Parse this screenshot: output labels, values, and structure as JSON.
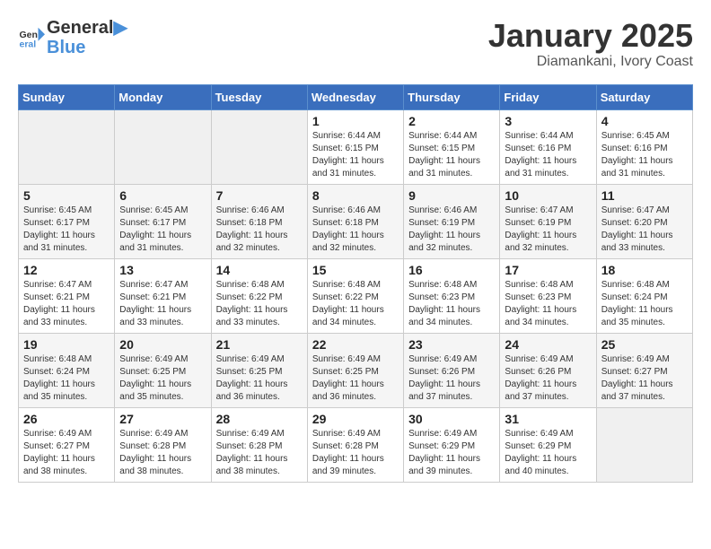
{
  "header": {
    "logo_line1": "General",
    "logo_line2": "Blue",
    "title": "January 2025",
    "subtitle": "Diamankani, Ivory Coast"
  },
  "weekdays": [
    "Sunday",
    "Monday",
    "Tuesday",
    "Wednesday",
    "Thursday",
    "Friday",
    "Saturday"
  ],
  "weeks": [
    [
      {
        "day": "",
        "info": ""
      },
      {
        "day": "",
        "info": ""
      },
      {
        "day": "",
        "info": ""
      },
      {
        "day": "1",
        "info": "Sunrise: 6:44 AM\nSunset: 6:15 PM\nDaylight: 11 hours\nand 31 minutes."
      },
      {
        "day": "2",
        "info": "Sunrise: 6:44 AM\nSunset: 6:15 PM\nDaylight: 11 hours\nand 31 minutes."
      },
      {
        "day": "3",
        "info": "Sunrise: 6:44 AM\nSunset: 6:16 PM\nDaylight: 11 hours\nand 31 minutes."
      },
      {
        "day": "4",
        "info": "Sunrise: 6:45 AM\nSunset: 6:16 PM\nDaylight: 11 hours\nand 31 minutes."
      }
    ],
    [
      {
        "day": "5",
        "info": "Sunrise: 6:45 AM\nSunset: 6:17 PM\nDaylight: 11 hours\nand 31 minutes."
      },
      {
        "day": "6",
        "info": "Sunrise: 6:45 AM\nSunset: 6:17 PM\nDaylight: 11 hours\nand 31 minutes."
      },
      {
        "day": "7",
        "info": "Sunrise: 6:46 AM\nSunset: 6:18 PM\nDaylight: 11 hours\nand 32 minutes."
      },
      {
        "day": "8",
        "info": "Sunrise: 6:46 AM\nSunset: 6:18 PM\nDaylight: 11 hours\nand 32 minutes."
      },
      {
        "day": "9",
        "info": "Sunrise: 6:46 AM\nSunset: 6:19 PM\nDaylight: 11 hours\nand 32 minutes."
      },
      {
        "day": "10",
        "info": "Sunrise: 6:47 AM\nSunset: 6:19 PM\nDaylight: 11 hours\nand 32 minutes."
      },
      {
        "day": "11",
        "info": "Sunrise: 6:47 AM\nSunset: 6:20 PM\nDaylight: 11 hours\nand 33 minutes."
      }
    ],
    [
      {
        "day": "12",
        "info": "Sunrise: 6:47 AM\nSunset: 6:21 PM\nDaylight: 11 hours\nand 33 minutes."
      },
      {
        "day": "13",
        "info": "Sunrise: 6:47 AM\nSunset: 6:21 PM\nDaylight: 11 hours\nand 33 minutes."
      },
      {
        "day": "14",
        "info": "Sunrise: 6:48 AM\nSunset: 6:22 PM\nDaylight: 11 hours\nand 33 minutes."
      },
      {
        "day": "15",
        "info": "Sunrise: 6:48 AM\nSunset: 6:22 PM\nDaylight: 11 hours\nand 34 minutes."
      },
      {
        "day": "16",
        "info": "Sunrise: 6:48 AM\nSunset: 6:23 PM\nDaylight: 11 hours\nand 34 minutes."
      },
      {
        "day": "17",
        "info": "Sunrise: 6:48 AM\nSunset: 6:23 PM\nDaylight: 11 hours\nand 34 minutes."
      },
      {
        "day": "18",
        "info": "Sunrise: 6:48 AM\nSunset: 6:24 PM\nDaylight: 11 hours\nand 35 minutes."
      }
    ],
    [
      {
        "day": "19",
        "info": "Sunrise: 6:48 AM\nSunset: 6:24 PM\nDaylight: 11 hours\nand 35 minutes."
      },
      {
        "day": "20",
        "info": "Sunrise: 6:49 AM\nSunset: 6:25 PM\nDaylight: 11 hours\nand 35 minutes."
      },
      {
        "day": "21",
        "info": "Sunrise: 6:49 AM\nSunset: 6:25 PM\nDaylight: 11 hours\nand 36 minutes."
      },
      {
        "day": "22",
        "info": "Sunrise: 6:49 AM\nSunset: 6:25 PM\nDaylight: 11 hours\nand 36 minutes."
      },
      {
        "day": "23",
        "info": "Sunrise: 6:49 AM\nSunset: 6:26 PM\nDaylight: 11 hours\nand 37 minutes."
      },
      {
        "day": "24",
        "info": "Sunrise: 6:49 AM\nSunset: 6:26 PM\nDaylight: 11 hours\nand 37 minutes."
      },
      {
        "day": "25",
        "info": "Sunrise: 6:49 AM\nSunset: 6:27 PM\nDaylight: 11 hours\nand 37 minutes."
      }
    ],
    [
      {
        "day": "26",
        "info": "Sunrise: 6:49 AM\nSunset: 6:27 PM\nDaylight: 11 hours\nand 38 minutes."
      },
      {
        "day": "27",
        "info": "Sunrise: 6:49 AM\nSunset: 6:28 PM\nDaylight: 11 hours\nand 38 minutes."
      },
      {
        "day": "28",
        "info": "Sunrise: 6:49 AM\nSunset: 6:28 PM\nDaylight: 11 hours\nand 38 minutes."
      },
      {
        "day": "29",
        "info": "Sunrise: 6:49 AM\nSunset: 6:28 PM\nDaylight: 11 hours\nand 39 minutes."
      },
      {
        "day": "30",
        "info": "Sunrise: 6:49 AM\nSunset: 6:29 PM\nDaylight: 11 hours\nand 39 minutes."
      },
      {
        "day": "31",
        "info": "Sunrise: 6:49 AM\nSunset: 6:29 PM\nDaylight: 11 hours\nand 40 minutes."
      },
      {
        "day": "",
        "info": ""
      }
    ]
  ]
}
